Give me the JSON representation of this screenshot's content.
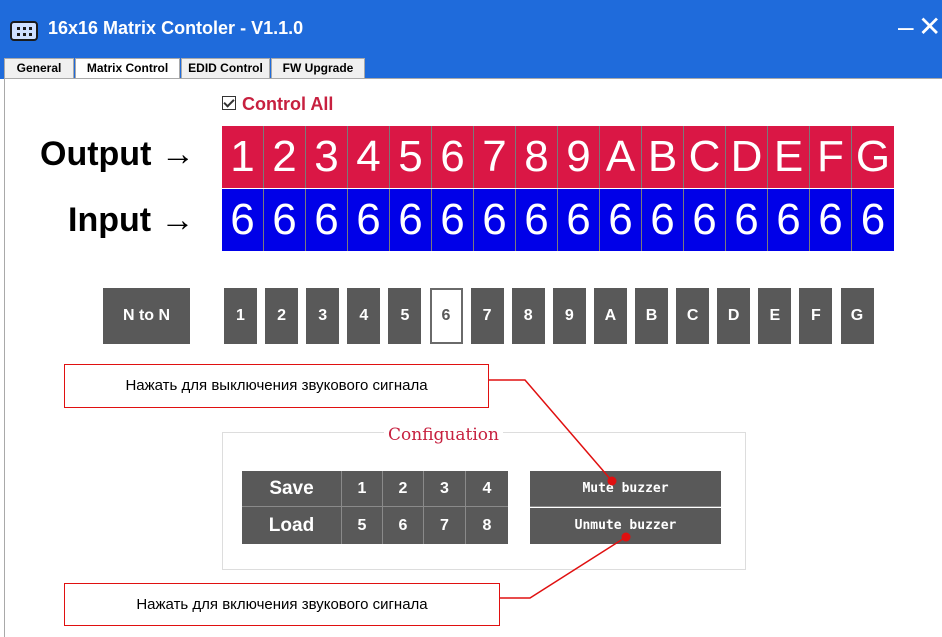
{
  "window": {
    "title": "16x16 Matrix Contoler - V1.1.0",
    "minimize": "–",
    "close": "✕"
  },
  "tabs": [
    "General",
    "Matrix Control",
    "EDID Control",
    "FW Upgrade"
  ],
  "control_all": "Control All",
  "output_label": "Output →",
  "input_label": "Input →",
  "outputs": [
    "1",
    "2",
    "3",
    "4",
    "5",
    "6",
    "7",
    "8",
    "9",
    "A",
    "B",
    "C",
    "D",
    "E",
    "F",
    "G"
  ],
  "inputs": [
    "6",
    "6",
    "6",
    "6",
    "6",
    "6",
    "6",
    "6",
    "6",
    "6",
    "6",
    "6",
    "6",
    "6",
    "6",
    "6"
  ],
  "ntoN": "N to N",
  "input_buttons": [
    "1",
    "2",
    "3",
    "4",
    "5",
    "6",
    "7",
    "8",
    "9",
    "A",
    "B",
    "C",
    "D",
    "E",
    "F",
    "G"
  ],
  "selected_input": "6",
  "callouts": {
    "mute_note": "Нажать для выключения звукового сигнала",
    "unmute_note": "Нажать для включения звукового сигнала"
  },
  "config": {
    "title": "Configuation",
    "save": "Save",
    "load": "Load",
    "save_slots": [
      "1",
      "2",
      "3",
      "4"
    ],
    "load_slots": [
      "5",
      "6",
      "7",
      "8"
    ],
    "mute_buzzer": "Mute buzzer",
    "unmute_buzzer": "Unmute buzzer"
  },
  "colors": {
    "titlebar": "#1F6BDB",
    "output_strip": "#DA1745",
    "input_strip": "#0000E8",
    "button_gray": "#595959",
    "accent_red": "#C7203F",
    "callout_border": "#E01010"
  },
  "icons": {
    "app": "matrix-device-icon"
  }
}
